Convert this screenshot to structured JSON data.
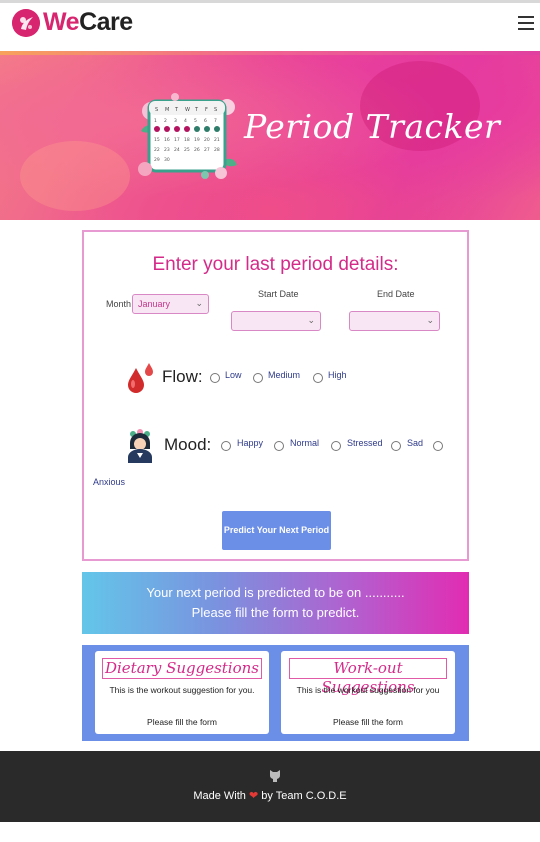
{
  "brand": {
    "name_part1": "We",
    "name_part2": "Care"
  },
  "hero": {
    "title": "Period Tracker"
  },
  "form": {
    "title": "Enter your last period details:",
    "month_label": "Month",
    "month_value": "January",
    "start_date_label": "Start Date",
    "end_date_label": "End Date",
    "flow_label": "Flow:",
    "flow_options": [
      "Low",
      "Medium",
      "High"
    ],
    "mood_label": "Mood:",
    "mood_options": [
      "Happy",
      "Normal",
      "Stressed",
      "Sad",
      "Anxious"
    ],
    "predict_button": "Predict Your Next Period"
  },
  "result": {
    "line1": "Your next period is predicted to be on ...........",
    "line2": "Please fill the form to predict."
  },
  "suggestions": {
    "dietary_title": "Dietary Suggestions",
    "dietary_text": "This is the workout suggestion for you.",
    "dietary_fill": "Please fill the form",
    "workout_title": "Work-out Suggestions",
    "workout_text": "This is the workout suggestion for you",
    "workout_fill": "Please fill the form"
  },
  "footer": {
    "made_with": "Made With",
    "by_team": "by Team C.O.D.E"
  },
  "icons": {
    "logo": "flower-logo-icon",
    "menu": "hamburger-menu-icon",
    "calendar": "calendar-illustration-icon",
    "flow": "blood-drops-icon",
    "mood": "woman-avatar-icon",
    "github": "github-icon",
    "heart": "heart-icon"
  },
  "colors": {
    "accent_pink": "#d42b8a",
    "button_blue": "#6b8ee6",
    "footer_bg": "#2a2a2a"
  }
}
